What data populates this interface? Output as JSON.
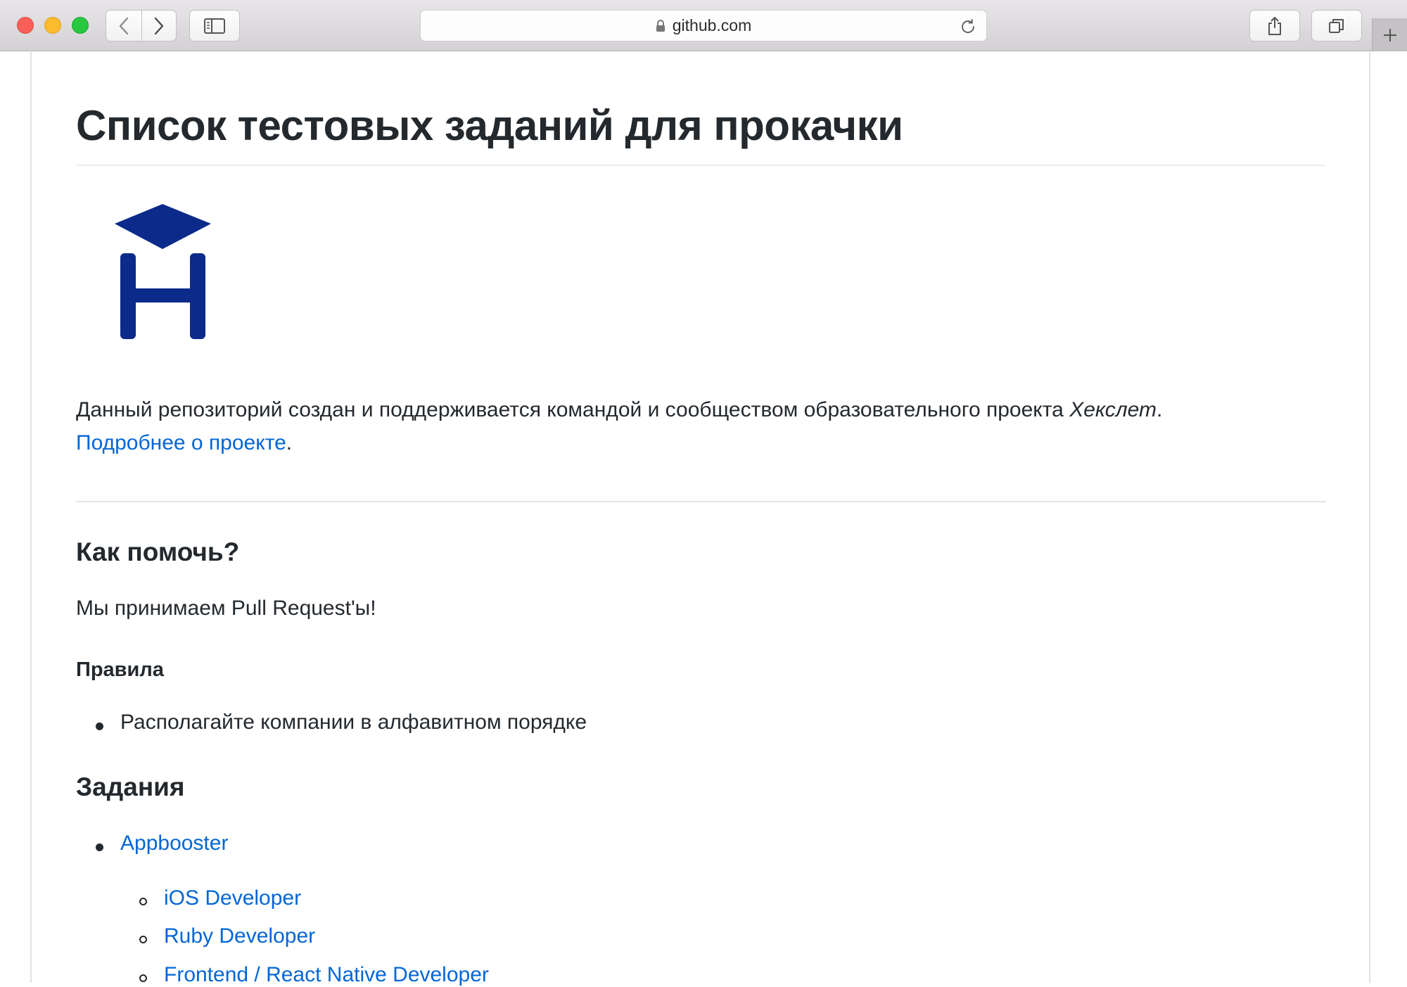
{
  "browser": {
    "url": "github.com",
    "icons": {
      "back": "chevron-left-icon",
      "forward": "chevron-right-icon",
      "sidebar": "sidebar-icon",
      "lock": "lock-icon",
      "reload": "reload-icon",
      "share": "share-icon",
      "tabs": "tabs-icon",
      "new_tab": "plus-icon"
    }
  },
  "page": {
    "title": "Список тестовых заданий для прокачки",
    "intro_text": "Данный репозиторий создан и поддерживается командой и сообществом образовательного проекта ",
    "intro_project": "Хекслет",
    "intro_end": ".",
    "more_link": "Подробнее о проекте",
    "more_end": ".",
    "help_heading": "Как помочь?",
    "help_text": "Мы принимаем Pull Request'ы!",
    "rules_heading": "Правила",
    "rules": [
      "Располагайте компании в алфавитном порядке"
    ],
    "tasks_heading": "Задания",
    "companies": [
      {
        "name": "Appbooster",
        "jobs": [
          "iOS Developer",
          "Ruby Developer",
          "Frontend / React Native Developer"
        ]
      }
    ]
  },
  "colors": {
    "link": "#0366d6",
    "text": "#24292e",
    "logo": "#0b2a8a"
  }
}
